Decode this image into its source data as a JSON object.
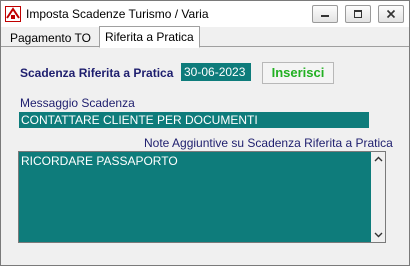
{
  "window": {
    "title": "Imposta Scadenze Turismo / Varia",
    "icon": "app-icon"
  },
  "titlebar_buttons": {
    "minimize": "minimize-icon",
    "maximize": "maximize-icon",
    "close": "close-icon"
  },
  "tabs": [
    {
      "label": "Pagamento TO",
      "active": false
    },
    {
      "label": "Riferita a Pratica",
      "active": true
    }
  ],
  "form": {
    "scadenza_label": "Scadenza Riferita a Pratica",
    "scadenza_value": "30-06-2023",
    "inserisci_label": "Inserisci",
    "messaggio_label": "Messaggio Scadenza",
    "messaggio_value": "CONTATTARE CLIENTE PER DOCUMENTI",
    "note_label": "Note Aggiuntive su Scadenza Riferita a Pratica",
    "note_value": "RICORDARE PASSAPORTO"
  },
  "colors": {
    "field_background": "#0e7c7b",
    "label_color": "#1e1e6e",
    "button_text": "#22b022"
  }
}
